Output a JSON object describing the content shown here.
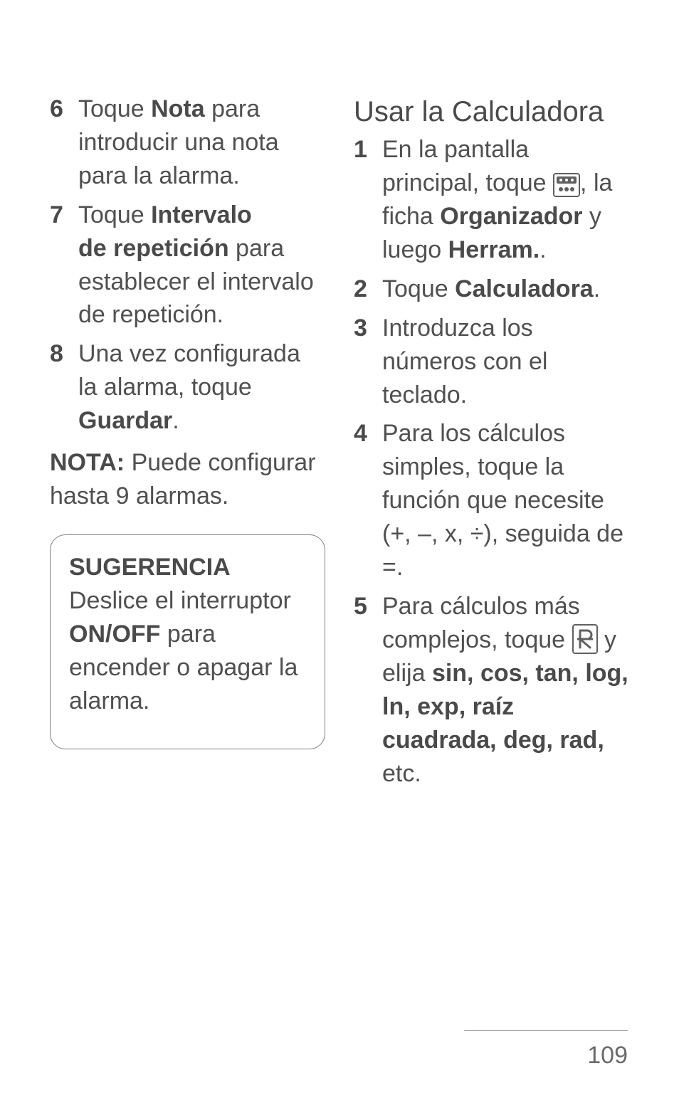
{
  "left": {
    "items": [
      {
        "num": "6",
        "pre": "Toque ",
        "bold": "Nota",
        "post": " para introducir una nota para la alarma."
      },
      {
        "num": "7",
        "pre": "Toque ",
        "bold": "Intervalo de repetición",
        "post": " para establecer el intervalo de repetición."
      },
      {
        "num": "8",
        "pre": "Una vez configurada la alarma, toque ",
        "bold": "Guardar",
        "post": "."
      }
    ],
    "note_label": "NOTA:",
    "note_text": " Puede configurar hasta 9 alarmas.",
    "tip_label": "SUGERENCIA",
    "tip_pre": " Deslice el interruptor ",
    "tip_bold": "ON/OFF",
    "tip_post": " para encender o apagar la alarma."
  },
  "right": {
    "heading": "Usar la Calculadora",
    "items": [
      {
        "num": "1",
        "segments": [
          {
            "t": "text",
            "v": "En la pantalla principal, toque "
          },
          {
            "t": "icon",
            "v": "apps"
          },
          {
            "t": "text",
            "v": ", la ficha "
          },
          {
            "t": "bold",
            "v": "Organizador"
          },
          {
            "t": "text",
            "v": " y luego "
          },
          {
            "t": "bold",
            "v": "Herram."
          },
          {
            "t": "text",
            "v": "."
          }
        ]
      },
      {
        "num": "2",
        "segments": [
          {
            "t": "text",
            "v": "Toque "
          },
          {
            "t": "bold",
            "v": "Calculadora"
          },
          {
            "t": "text",
            "v": "."
          }
        ]
      },
      {
        "num": "3",
        "segments": [
          {
            "t": "text",
            "v": "Introduzca los números con el teclado."
          }
        ]
      },
      {
        "num": "4",
        "segments": [
          {
            "t": "text",
            "v": "Para los cálculos simples, toque la función que necesite (+, –, x, ÷), seguida de =."
          }
        ]
      },
      {
        "num": "5",
        "segments": [
          {
            "t": "text",
            "v": "Para cálculos más complejos, toque "
          },
          {
            "t": "icon",
            "v": "advanced"
          },
          {
            "t": "text",
            "v": " y elija "
          },
          {
            "t": "bold",
            "v": "sin, cos, tan, log, ln, exp, raíz cuadrada, deg, rad,"
          },
          {
            "t": "text",
            "v": " etc."
          }
        ]
      }
    ]
  },
  "icons": {
    "apps": "apps-icon",
    "advanced": "advanced-icon"
  },
  "page_number": "109"
}
